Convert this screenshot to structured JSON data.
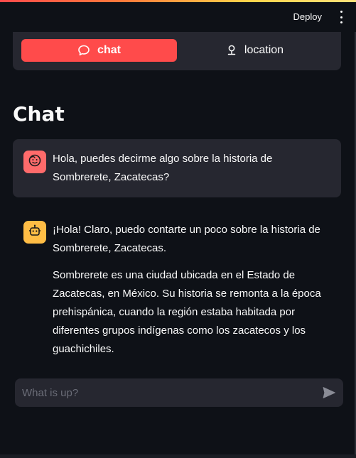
{
  "header": {
    "deploy_label": "Deploy",
    "accent_gradient": [
      "#ff4b4b",
      "#ffd54a"
    ]
  },
  "tabs": [
    {
      "label": "chat",
      "icon": "chat-bubble-icon",
      "active": true
    },
    {
      "label": "location",
      "icon": "map-pin-icon",
      "active": false
    }
  ],
  "page": {
    "title": "Chat"
  },
  "messages": [
    {
      "role": "user",
      "avatar_icon": "face-icon",
      "avatar_color": "#ff6b6b",
      "paragraphs": [
        "Hola, puedes decirme algo sobre la historia de Sombrerete, Zacatecas?"
      ]
    },
    {
      "role": "assistant",
      "avatar_icon": "robot-icon",
      "avatar_color": "#ffbd45",
      "paragraphs": [
        "¡Hola! Claro, puedo contarte un poco sobre la historia de Sombrerete, Zacatecas.",
        "Sombrerete es una ciudad ubicada en el Estado de Zacatecas, en México. Su historia se remonta a la época prehispánica, cuando la región estaba habitada por diferentes grupos indígenas como los zacatecos y los guachichiles."
      ]
    }
  ],
  "chat_input": {
    "placeholder": "What is up?",
    "value": "",
    "send_icon": "send-icon"
  },
  "colors": {
    "background": "#0e1117",
    "panel": "#262730",
    "primary": "#ff4b4b"
  }
}
